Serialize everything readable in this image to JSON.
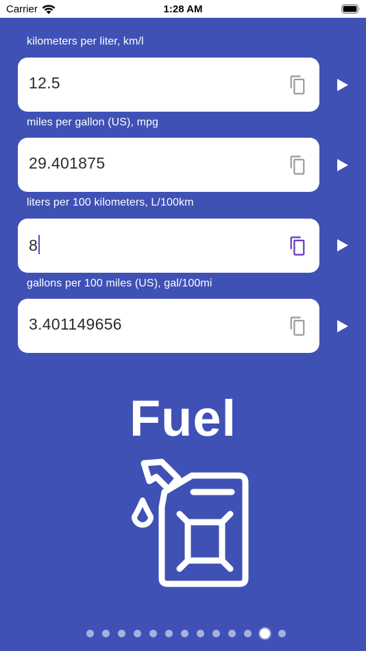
{
  "status": {
    "carrier": "Carrier",
    "time": "1:28 AM"
  },
  "fields": [
    {
      "label": "kilometers per liter, km/l",
      "value": "12.5"
    },
    {
      "label": "miles per gallon (US), mpg",
      "value": "29.401875"
    },
    {
      "label": "liters per 100 kilometers, L/100km",
      "value": "8"
    },
    {
      "label": "gallons per 100 miles (US), gal/100mi",
      "value": "3.401149656"
    }
  ],
  "focused_field_index": 2,
  "title": "Fuel",
  "icons": {
    "copy": "copy-icon",
    "play": "play-icon",
    "fuel": "fuel-can-icon",
    "wifi": "wifi-icon",
    "battery": "battery-icon"
  },
  "colors": {
    "background": "#3f51b5",
    "field_background": "#ffffff",
    "copy_icon": "#9e9e9e",
    "copy_icon_active": "#6a3fbf"
  },
  "pagination": {
    "total": 13,
    "current": 12
  }
}
